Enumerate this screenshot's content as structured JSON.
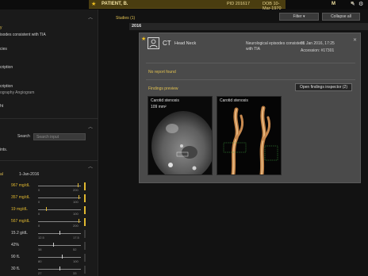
{
  "topbar": {
    "patient_name": "PATIENT, B.",
    "pid": "PID 201617",
    "dob": "DOB 10-Mar-1970 (46y)",
    "sex": "M"
  },
  "left_panel": {
    "lines": [
      {
        "text": "y",
        "style": "gold"
      },
      {
        "text": "isodes consistent with TIA",
        "style": "normal"
      },
      {
        "text": "cies",
        "style": "normal"
      },
      {
        "text": "cription",
        "style": "normal"
      },
      {
        "text": "cription",
        "style": "normal"
      },
      {
        "text": "ography Angiogram",
        "style": "muted"
      },
      {
        "text": "ht",
        "style": "normal"
      }
    ],
    "search_label": "Search",
    "search_placeholder": "Search input",
    "search_hint": "ints.",
    "date_column_label": "al",
    "date_column": "1-Jan-2016",
    "labs": [
      {
        "value": "967 mg/dL",
        "style": "gold",
        "min": "0",
        "max": "200",
        "level": 0.92
      },
      {
        "value": "357 mg/dL",
        "style": "gold",
        "min": "0",
        "max": "100",
        "level": 0.95
      },
      {
        "value": "19 mg/dL",
        "style": "gold",
        "min": "0",
        "max": "100",
        "level": 0.18
      },
      {
        "value": "567 mg/dL",
        "style": "gold",
        "min": "0",
        "max": "200",
        "level": 0.95
      },
      {
        "value": "15.2 g/dL",
        "style": "normal",
        "min": "12.5",
        "max": "17.5",
        "level": 0.5
      },
      {
        "value": "42%",
        "style": "normal",
        "min": "38",
        "max": "52",
        "level": 0.35
      },
      {
        "value": "90 fL",
        "style": "normal",
        "min": "80",
        "max": "100",
        "level": 0.55
      },
      {
        "value": "30 fL",
        "style": "normal",
        "min": "27",
        "max": "33",
        "level": 0.5
      },
      {
        "value": "33.5%",
        "style": "normal",
        "min": "32.5",
        "max": "36.4",
        "level": 0.45
      }
    ]
  },
  "main": {
    "filter_label": "Filter",
    "collapse_label": "Collapse all",
    "studies_label": "Studies (1)",
    "year": "2016",
    "card": {
      "modality": "CT",
      "region": "Head Neck",
      "description": "Neurological episodes consistent with TIA",
      "date": "01 Jan 2016, 17:25",
      "accession": "Accession: #17301",
      "no_report": "No report found",
      "findings_label": "Findings preview",
      "open_findings_label": "Open findings inspector (2)",
      "thumbnails": [
        {
          "title": "Carotid stenosis",
          "subtitle": "109 mm²"
        },
        {
          "title": "Carotid stenosis",
          "subtitle": ""
        }
      ]
    }
  },
  "colors": {
    "accent_gold": "#e0c050",
    "patient_bar": "#4a3d10",
    "card_bg": "#4a4a4a"
  },
  "icons": [
    "app-logo-icon",
    "patient-star-icon",
    "user-avatar-icon",
    "chevron-up-icon",
    "close-icon",
    "funnel-icon"
  ]
}
